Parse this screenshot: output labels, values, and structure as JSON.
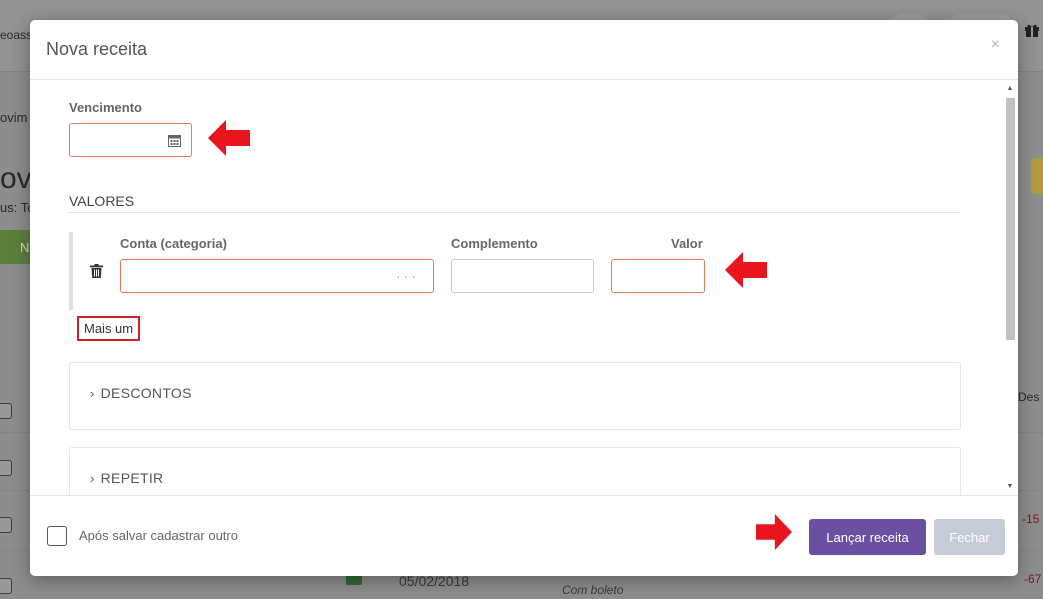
{
  "background": {
    "top_text": "eoass",
    "side_text_1": "ovim",
    "side_heading": "ov",
    "side_text_2": "us: To",
    "side_button": "N",
    "column_header": "Des",
    "row_date": "05/02/2018",
    "row_note": "Com boleto",
    "value_1": "-15",
    "value_2": "-67"
  },
  "modal": {
    "title": "Nova receita",
    "close_label": "×",
    "vencimento_label": "Vencimento",
    "vencimento_value": "",
    "valores_title": "VALORES",
    "conta_label": "Conta (categoria)",
    "conta_value": "",
    "conta_dots": "···",
    "complemento_label": "Complemento",
    "complemento_value": "",
    "valor_label": "Valor",
    "valor_value": "",
    "mais_um_label": "Mais um",
    "descontos_label": "DESCONTOS",
    "repetir_label": "REPETIR",
    "footer": {
      "checkbox_label": "Após salvar cadastrar outro",
      "primary_button": "Lançar receita",
      "secondary_button": "Fechar"
    }
  },
  "colors": {
    "primary": "#6a4fa3",
    "error_border": "#e07a5f",
    "annotation_red": "#e8141e",
    "disabled": "#c6ccd6"
  },
  "icons": [
    "calendar-icon",
    "trash-icon",
    "chevron-right-icon",
    "close-icon",
    "gift-icon",
    "arrow-left-icon",
    "arrow-right-icon"
  ]
}
